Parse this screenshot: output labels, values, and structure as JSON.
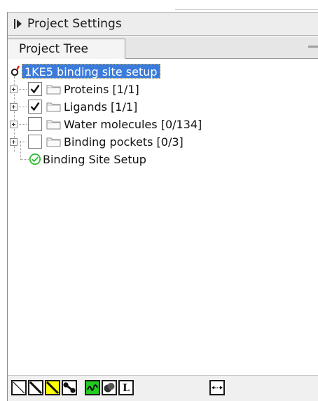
{
  "panel": {
    "title": "Project Settings"
  },
  "tabs": [
    {
      "label": "Project Tree"
    }
  ],
  "tree": {
    "root": {
      "label": "1KE5 binding site setup"
    },
    "items": [
      {
        "label": "Proteins [1/1]",
        "checked": true
      },
      {
        "label": "Ligands [1/1]",
        "checked": true
      },
      {
        "label": "Water molecules [0/134]",
        "checked": false
      },
      {
        "label": "Binding pockets [0/3]",
        "checked": false
      }
    ],
    "setup": {
      "label": "Binding Site Setup"
    }
  },
  "toolbar": {
    "tools": [
      {
        "icon": "line-view-icon"
      },
      {
        "icon": "stick-view-icon"
      },
      {
        "icon": "highlight-stick-icon",
        "color": "#ffff00"
      },
      {
        "icon": "ball-stick-icon"
      },
      {
        "icon": "ribbon-view-icon",
        "color": "#22cc22"
      },
      {
        "icon": "surface-view-icon"
      },
      {
        "icon": "label-icon",
        "text": "L"
      },
      {
        "icon": "unknown-square-icon"
      },
      {
        "icon": "measure-distance-icon"
      }
    ]
  },
  "colors": {
    "selection": "#3b7bdc",
    "header_bg": "#ededed",
    "check_ok": "#2eb82e"
  }
}
